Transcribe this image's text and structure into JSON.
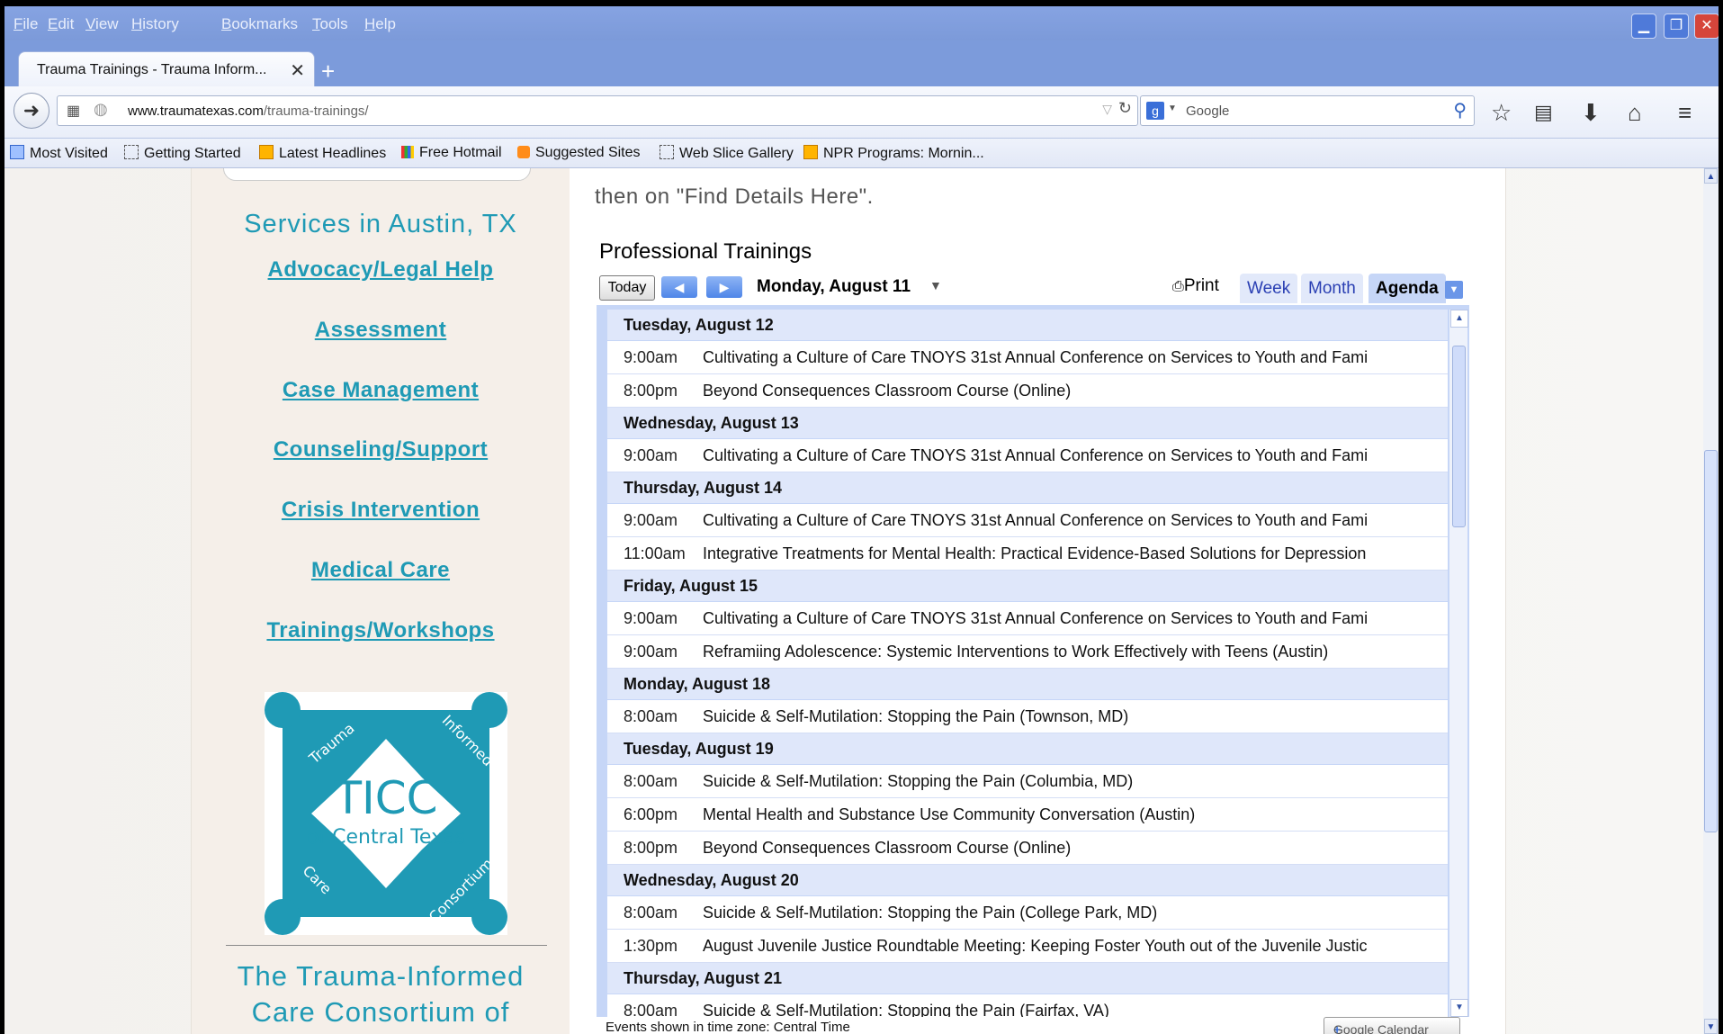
{
  "menu": [
    "File",
    "Edit",
    "View",
    "History",
    "Bookmarks",
    "Tools",
    "Help"
  ],
  "tab": {
    "title": "Trauma Trainings - Trauma Inform...",
    "close": "✕",
    "new_tab": "+"
  },
  "nav": {
    "url_host": "www.traumatexas.com",
    "url_path": "/trauma-trainings/",
    "search_placeholder": "Google"
  },
  "bookmarks": [
    {
      "label": "Most Visited",
      "icon": "mv"
    },
    {
      "label": "Getting Started",
      "icon": "page"
    },
    {
      "label": "Latest Headlines",
      "icon": "rss"
    },
    {
      "label": "Free Hotmail",
      "icon": "ms"
    },
    {
      "label": "Suggested Sites",
      "icon": "sug"
    },
    {
      "label": "Web Slice Gallery",
      "icon": "page"
    },
    {
      "label": "NPR Programs: Mornin...",
      "icon": "rss"
    }
  ],
  "sidebar": {
    "heading": "Services in Austin, TX",
    "links": [
      "Advocacy/Legal Help",
      "Assessment",
      "Case Management",
      "Counseling/Support",
      "Crisis Intervention",
      "Medical Care",
      "Trainings/Workshops"
    ],
    "logo": {
      "line1": "TICC",
      "line2": "of Central Texas",
      "ring_words": [
        "Trauma",
        "Informed",
        "Care",
        "Consortium"
      ]
    },
    "title_line1": "The Trauma-Informed",
    "title_line2": "Care Consortium of"
  },
  "intro_text": "then on \"Find Details Here\".",
  "calendar": {
    "title": "Professional Trainings",
    "today_label": "Today",
    "date_range": "Monday, August 11",
    "print_label": "Print",
    "view_tabs": [
      "Week",
      "Month",
      "Agenda"
    ],
    "active_view": "Agenda",
    "days": [
      {
        "date": "Tuesday, August 12",
        "events": [
          {
            "time": "9:00am",
            "title": "Cultivating a Culture of Care TNOYS 31st Annual Conference on Services to Youth and Fami"
          },
          {
            "time": "8:00pm",
            "title": "Beyond Consequences Classroom Course (Online)"
          }
        ]
      },
      {
        "date": "Wednesday, August 13",
        "events": [
          {
            "time": "9:00am",
            "title": "Cultivating a Culture of Care TNOYS 31st Annual Conference on Services to Youth and Fami"
          }
        ]
      },
      {
        "date": "Thursday, August 14",
        "events": [
          {
            "time": "9:00am",
            "title": "Cultivating a Culture of Care TNOYS 31st Annual Conference on Services to Youth and Fami"
          },
          {
            "time": "11:00am",
            "title": "Integrative Treatments for Mental Health: Practical Evidence-Based Solutions for Depression"
          }
        ]
      },
      {
        "date": "Friday, August 15",
        "events": [
          {
            "time": "9:00am",
            "title": "Cultivating a Culture of Care TNOYS 31st Annual Conference on Services to Youth and Fami"
          },
          {
            "time": "9:00am",
            "title": "Reframiing Adolescence: Systemic Interventions to Work Effectively with Teens (Austin)"
          }
        ]
      },
      {
        "date": "Monday, August 18",
        "events": [
          {
            "time": "8:00am",
            "title": "Suicide & Self-Mutilation: Stopping the Pain (Townson, MD)"
          }
        ]
      },
      {
        "date": "Tuesday, August 19",
        "events": [
          {
            "time": "8:00am",
            "title": "Suicide & Self-Mutilation: Stopping the Pain (Columbia, MD)"
          },
          {
            "time": "6:00pm",
            "title": "Mental Health and Substance Use Community Conversation (Austin)"
          },
          {
            "time": "8:00pm",
            "title": "Beyond Consequences Classroom Course (Online)"
          }
        ]
      },
      {
        "date": "Wednesday, August 20",
        "events": [
          {
            "time": "8:00am",
            "title": "Suicide & Self-Mutilation: Stopping the Pain (College Park, MD)"
          },
          {
            "time": "1:30pm",
            "title": "August Juvenile Justice Roundtable Meeting: Keeping Foster Youth out of the Juvenile Justic"
          }
        ]
      },
      {
        "date": "Thursday, August 21",
        "events": [
          {
            "time": "8:00am",
            "title": "Suicide & Self-Mutilation: Stopping the Pain (Fairfax, VA)"
          }
        ]
      }
    ],
    "footer_timezone": "Events shown in time zone: Central Time",
    "google_calendar_label": "Google Calendar"
  },
  "colors": {
    "accent": "#1f9ab5",
    "chrome": "#7c9bdb",
    "agenda_bg": "#c6d6f7"
  }
}
